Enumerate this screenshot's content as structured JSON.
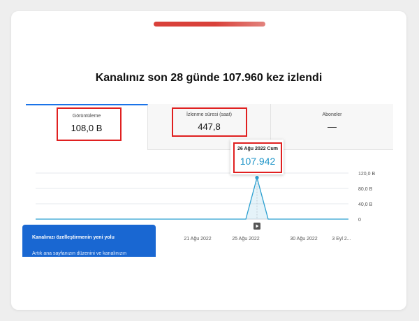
{
  "headline": "Kanalınız son 28 günde 107.960 kez izlendi",
  "tabs": [
    {
      "label": "Görüntüleme",
      "value": "108,0 B",
      "active": true
    },
    {
      "label": "İzlenme süresi (saat)",
      "value": "447,8",
      "active": false
    },
    {
      "label": "Aboneler",
      "value": "—",
      "active": false
    }
  ],
  "tooltip": {
    "date": "26 Ağu 2022 Cum",
    "value": "107.942"
  },
  "promo": {
    "title": "Kanalınızı özelleştirmenin yeni yolu",
    "body": "Artık ana sayfanızın düzenini ve kanalınızın"
  },
  "colors": {
    "accent": "#d9413a",
    "highlight": "#e02020",
    "line": "#2a9fd0",
    "promo_bg": "#1967d2",
    "tab_active": "#1a73e8"
  },
  "chart_data": {
    "type": "line",
    "x_tick_labels": [
      "21 Ağu 2022",
      "25 Ağu 2022",
      "30 Ağu 2022",
      "3 Eyl 2..."
    ],
    "y_tick_labels": [
      "120,0 B",
      "80,0 B",
      "40,0 B",
      "0"
    ],
    "ylim": [
      0,
      120000
    ],
    "x": [
      "24 Ağu 2022",
      "25 Ağu 2022",
      "26 Ağu 2022",
      "27 Ağu 2022",
      "28 Ağu 2022"
    ],
    "values": [
      0,
      0,
      107942,
      0,
      0
    ],
    "grid": true,
    "highlight_point": {
      "x": "26 Ağu 2022",
      "y": 107942
    }
  }
}
